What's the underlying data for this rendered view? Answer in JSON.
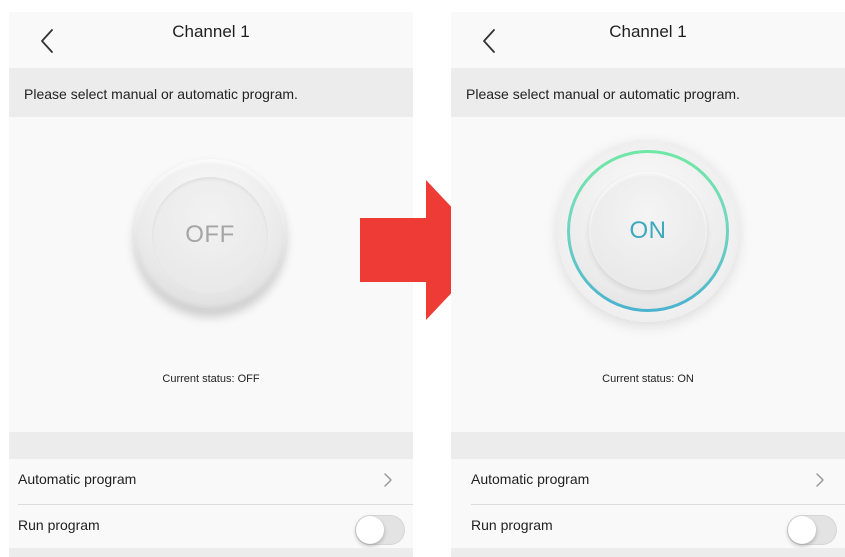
{
  "colors": {
    "arrow": "#ee3b35",
    "on_label": "#3da9be",
    "ring_top": "#6fe8a4",
    "ring_bottom": "#4ab2cf",
    "off_label": "#a5a5a5"
  },
  "screens": [
    {
      "nav": {
        "title": "Channel 1",
        "back_icon": "chevron-left-icon"
      },
      "prompt": "Please select manual or automatic program.",
      "power_button": {
        "label": "OFF",
        "state": "off"
      },
      "status": "Current status: OFF",
      "list": {
        "automatic_program": {
          "label": "Automatic program",
          "icon": "chevron-right-icon"
        },
        "run_program": {
          "label": "Run program",
          "toggle_on": false
        }
      }
    },
    {
      "nav": {
        "title": "Channel 1",
        "back_icon": "chevron-left-icon"
      },
      "prompt": "Please select manual or automatic program.",
      "power_button": {
        "label": "ON",
        "state": "on"
      },
      "status": "Current status: ON",
      "list": {
        "automatic_program": {
          "label": "Automatic program",
          "icon": "chevron-right-icon"
        },
        "run_program": {
          "label": "Run program",
          "toggle_on": false
        }
      }
    }
  ],
  "transition_icon": "right-arrow-icon"
}
